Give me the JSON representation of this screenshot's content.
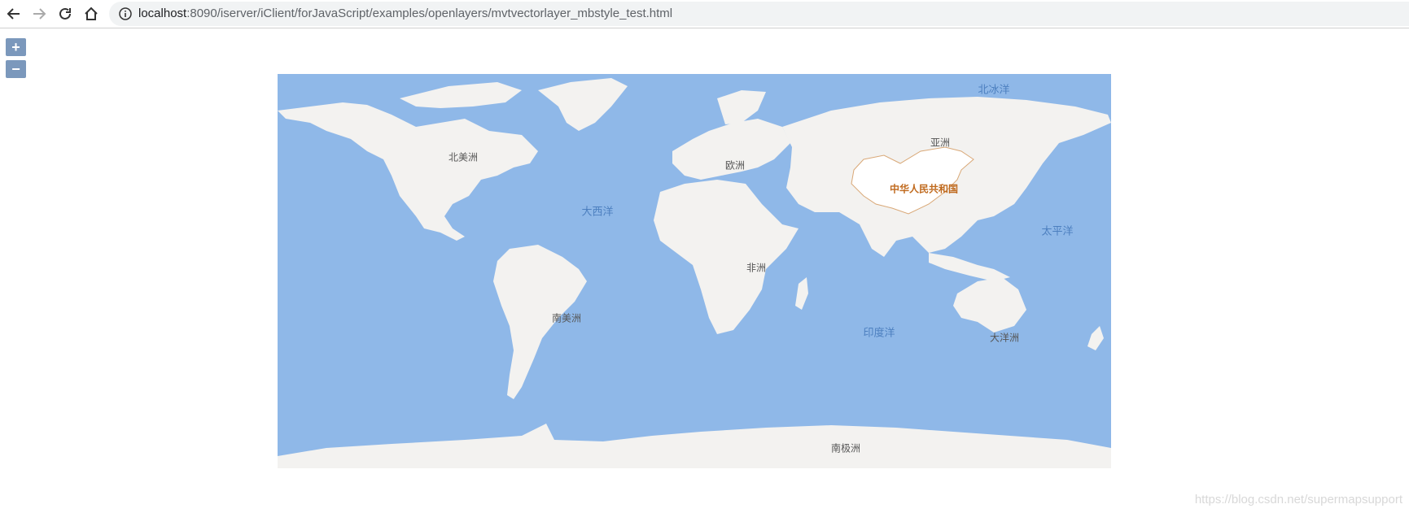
{
  "browser": {
    "url_host": "localhost",
    "url_path": ":8090/iserver/iClient/forJavaScript/examples/openlayers/mvtvectorlayer_mbstyle_test.html"
  },
  "zoom": {
    "in_label": "+",
    "out_label": "−"
  },
  "map": {
    "oceans": {
      "arctic": "北冰洋",
      "atlantic": "大西洋",
      "pacific": "太平洋",
      "indian": "印度洋"
    },
    "continents": {
      "north_america": "北美洲",
      "south_america": "南美洲",
      "europe": "欧洲",
      "asia": "亚洲",
      "africa": "非洲",
      "oceania": "大洋洲",
      "antarctica": "南极洲"
    },
    "country": "中华人民共和国",
    "colors": {
      "water": "#8fb8e8",
      "land": "#f3f2f0",
      "highlight_border": "#d9a877"
    }
  },
  "watermark": "https://blog.csdn.net/supermapsupport"
}
